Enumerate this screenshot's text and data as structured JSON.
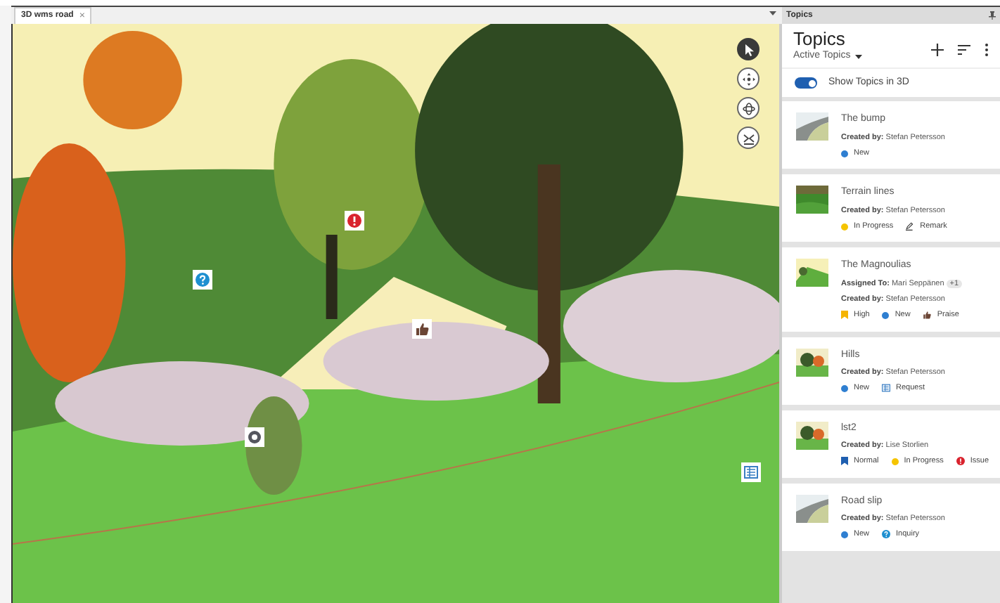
{
  "document_tab": {
    "title": "3D wms road",
    "close": "×"
  },
  "viewport": {
    "kind": "picture",
    "markers": [
      {
        "kind": "issue"
      },
      {
        "kind": "inquiry"
      },
      {
        "kind": "praise"
      },
      {
        "kind": "comment"
      },
      {
        "kind": "request"
      }
    ],
    "tools": [
      {
        "kind": "select",
        "selected": true
      },
      {
        "kind": "pan",
        "selected": false
      },
      {
        "kind": "orbit",
        "selected": false
      },
      {
        "kind": "walk",
        "selected": false
      }
    ]
  },
  "panel": {
    "title": "Topics",
    "heading": "Topics",
    "filter": "Active Topics",
    "toggle": {
      "label": "Show Topics in 3D",
      "on": true
    },
    "topics": [
      {
        "title": "The bump",
        "meta": [
          {
            "label": "Created by:",
            "value": "Stefan Petersson"
          }
        ],
        "tags": [
          {
            "kind": "status",
            "label": "New",
            "color": "#2f7fd1"
          }
        ]
      },
      {
        "title": "Terrain lines",
        "meta": [
          {
            "label": "Created by:",
            "value": "Stefan Petersson"
          }
        ],
        "tags": [
          {
            "kind": "status",
            "label": "In Progress",
            "color": "#f5c400"
          },
          {
            "kind": "remark",
            "label": "Remark"
          }
        ]
      },
      {
        "title": "The Magnoulias",
        "meta": [
          {
            "label": "Assigned To:",
            "value": "Mari Seppänen",
            "extra": "+1"
          },
          {
            "label": "Created by:",
            "value": "Stefan Petersson"
          }
        ],
        "tags": [
          {
            "kind": "priority",
            "label": "High",
            "color": "#f5b400"
          },
          {
            "kind": "status",
            "label": "New",
            "color": "#2f7fd1"
          },
          {
            "kind": "praise",
            "label": "Praise"
          }
        ]
      },
      {
        "title": "Hills",
        "meta": [
          {
            "label": "Created by:",
            "value": "Stefan Petersson"
          }
        ],
        "tags": [
          {
            "kind": "status",
            "label": "New",
            "color": "#2f7fd1"
          },
          {
            "kind": "request",
            "label": "Request"
          }
        ]
      },
      {
        "title": "lst2",
        "meta": [
          {
            "label": "Created by:",
            "value": "Lise Storlien"
          }
        ],
        "tags": [
          {
            "kind": "priority",
            "label": "Normal",
            "color": "#1f5fb0"
          },
          {
            "kind": "status",
            "label": "In Progress",
            "color": "#f5c400"
          },
          {
            "kind": "issue",
            "label": "Issue"
          }
        ]
      },
      {
        "title": "Road slip",
        "meta": [
          {
            "label": "Created by:",
            "value": "Stefan Petersson"
          }
        ],
        "tags": [
          {
            "kind": "status",
            "label": "New",
            "color": "#2f7fd1"
          },
          {
            "kind": "inquiry",
            "label": "Inquiry"
          }
        ]
      }
    ]
  }
}
